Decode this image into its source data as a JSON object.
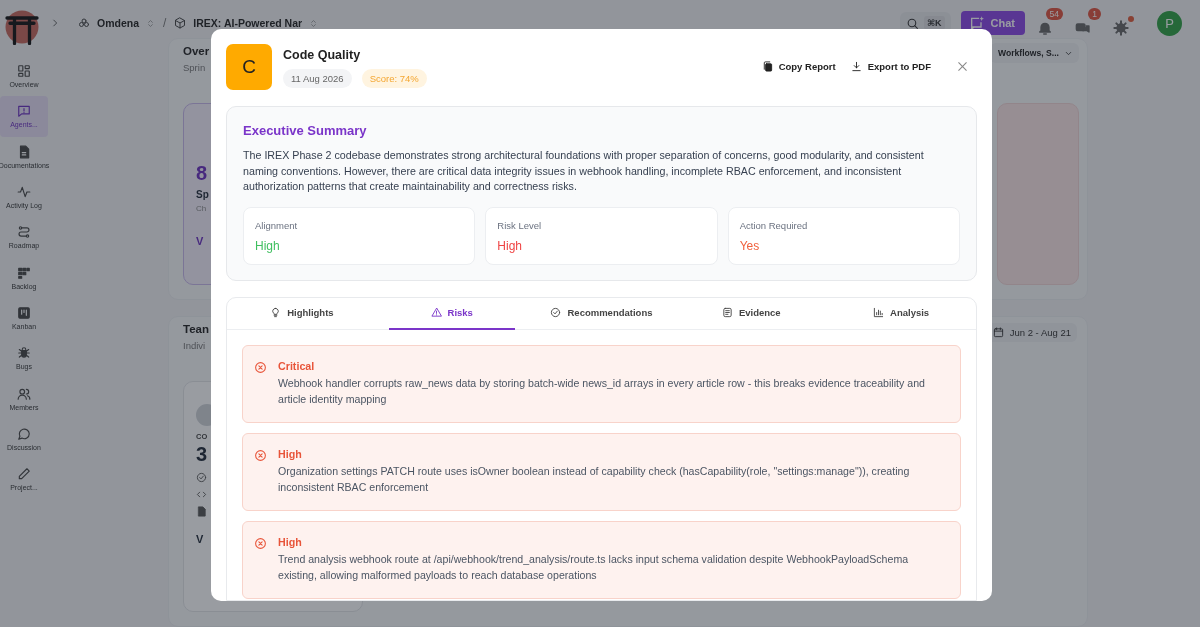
{
  "topbar": {
    "breadcrumbs": [
      {
        "label": "Omdena",
        "kind": "org"
      },
      {
        "label": "IREX: AI-Powered Nar",
        "kind": "project"
      }
    ],
    "separator": "/",
    "search_shortcut": "⌘K",
    "chat_button": "Chat",
    "notifications": [
      {
        "kind": "bell",
        "count": "54"
      },
      {
        "kind": "inbox",
        "count": "1"
      }
    ],
    "avatar": "P"
  },
  "sidebar": {
    "items": [
      {
        "label": "Overview",
        "kind": "grid",
        "selected": false
      },
      {
        "label": "Agents...",
        "kind": "alert",
        "selected": true
      },
      {
        "label": "Documentations",
        "kind": "doc",
        "selected": false
      },
      {
        "label": "Activity Log",
        "kind": "pulse",
        "selected": false
      },
      {
        "label": "Roadmap",
        "kind": "route",
        "selected": false
      },
      {
        "label": "Backlog",
        "kind": "blocks",
        "selected": false
      },
      {
        "label": "Kanban",
        "kind": "kanban",
        "selected": false
      },
      {
        "label": "Bugs",
        "kind": "bug",
        "selected": false
      },
      {
        "label": "Members",
        "kind": "users",
        "selected": false
      },
      {
        "label": "Discussion",
        "kind": "chat",
        "selected": false
      },
      {
        "label": "Project...",
        "kind": "pencil",
        "selected": false
      }
    ]
  },
  "background": {
    "overview_card": {
      "title": "Over",
      "subtitle": "Sprin",
      "filter": "Workflows, S...",
      "stat_card": {
        "value": "8",
        "title": "Sp",
        "caption": "Ch",
        "link": "V"
      }
    },
    "team_card": {
      "title": "Tean",
      "subtitle": "Indivi",
      "date_range": "Jun 2 - Aug 21",
      "member_card": {
        "label": "CO",
        "value": "3",
        "link": "V"
      }
    }
  },
  "modal": {
    "avatar": "C",
    "title": "Code Quality",
    "date": "11 Aug 2026",
    "score": "Score: 74%",
    "actions": [
      {
        "label": "Copy Report",
        "kind": "copy"
      },
      {
        "label": "Export to PDF",
        "kind": "download"
      }
    ],
    "summary": {
      "title": "Executive Summary",
      "text": "The IREX Phase 2 codebase demonstrates strong architectural foundations with proper separation of concerns, good modularity, and consistent naming conventions. However, there are critical data integrity issues in webhook handling, incomplete RBAC enforcement, and inconsistent authorization patterns that create maintainability and correctness risks.",
      "metrics": [
        {
          "label": "Alignment",
          "value": "High",
          "color": "#3fbf5f"
        },
        {
          "label": "Risk Level",
          "value": "High",
          "color": "#ef4444"
        },
        {
          "label": "Action Required",
          "value": "Yes",
          "color": "#f0603c"
        }
      ]
    },
    "tabs": [
      {
        "label": "Highlights",
        "kind": "bulb",
        "selected": false
      },
      {
        "label": "Risks",
        "kind": "warning",
        "selected": true
      },
      {
        "label": "Recommendations",
        "kind": "check",
        "selected": false
      },
      {
        "label": "Evidence",
        "kind": "list",
        "selected": false
      },
      {
        "label": "Analysis",
        "kind": "bars",
        "selected": false
      }
    ],
    "risks": [
      {
        "severity": "Critical",
        "text": "Webhook handler corrupts raw_news data by storing batch-wide news_id arrays in every article row - this breaks evidence traceability and article identity mapping"
      },
      {
        "severity": "High",
        "text": "Organization settings PATCH route uses isOwner boolean instead of capability check (hasCapability(role, \"settings:manage\")), creating inconsistent RBAC enforcement"
      },
      {
        "severity": "High",
        "text": "Trend analysis webhook route at /api/webhook/trend_analysis/route.ts lacks input schema validation despite WebhookPayloadSchema existing, allowing malformed payloads to reach database operations"
      }
    ]
  }
}
